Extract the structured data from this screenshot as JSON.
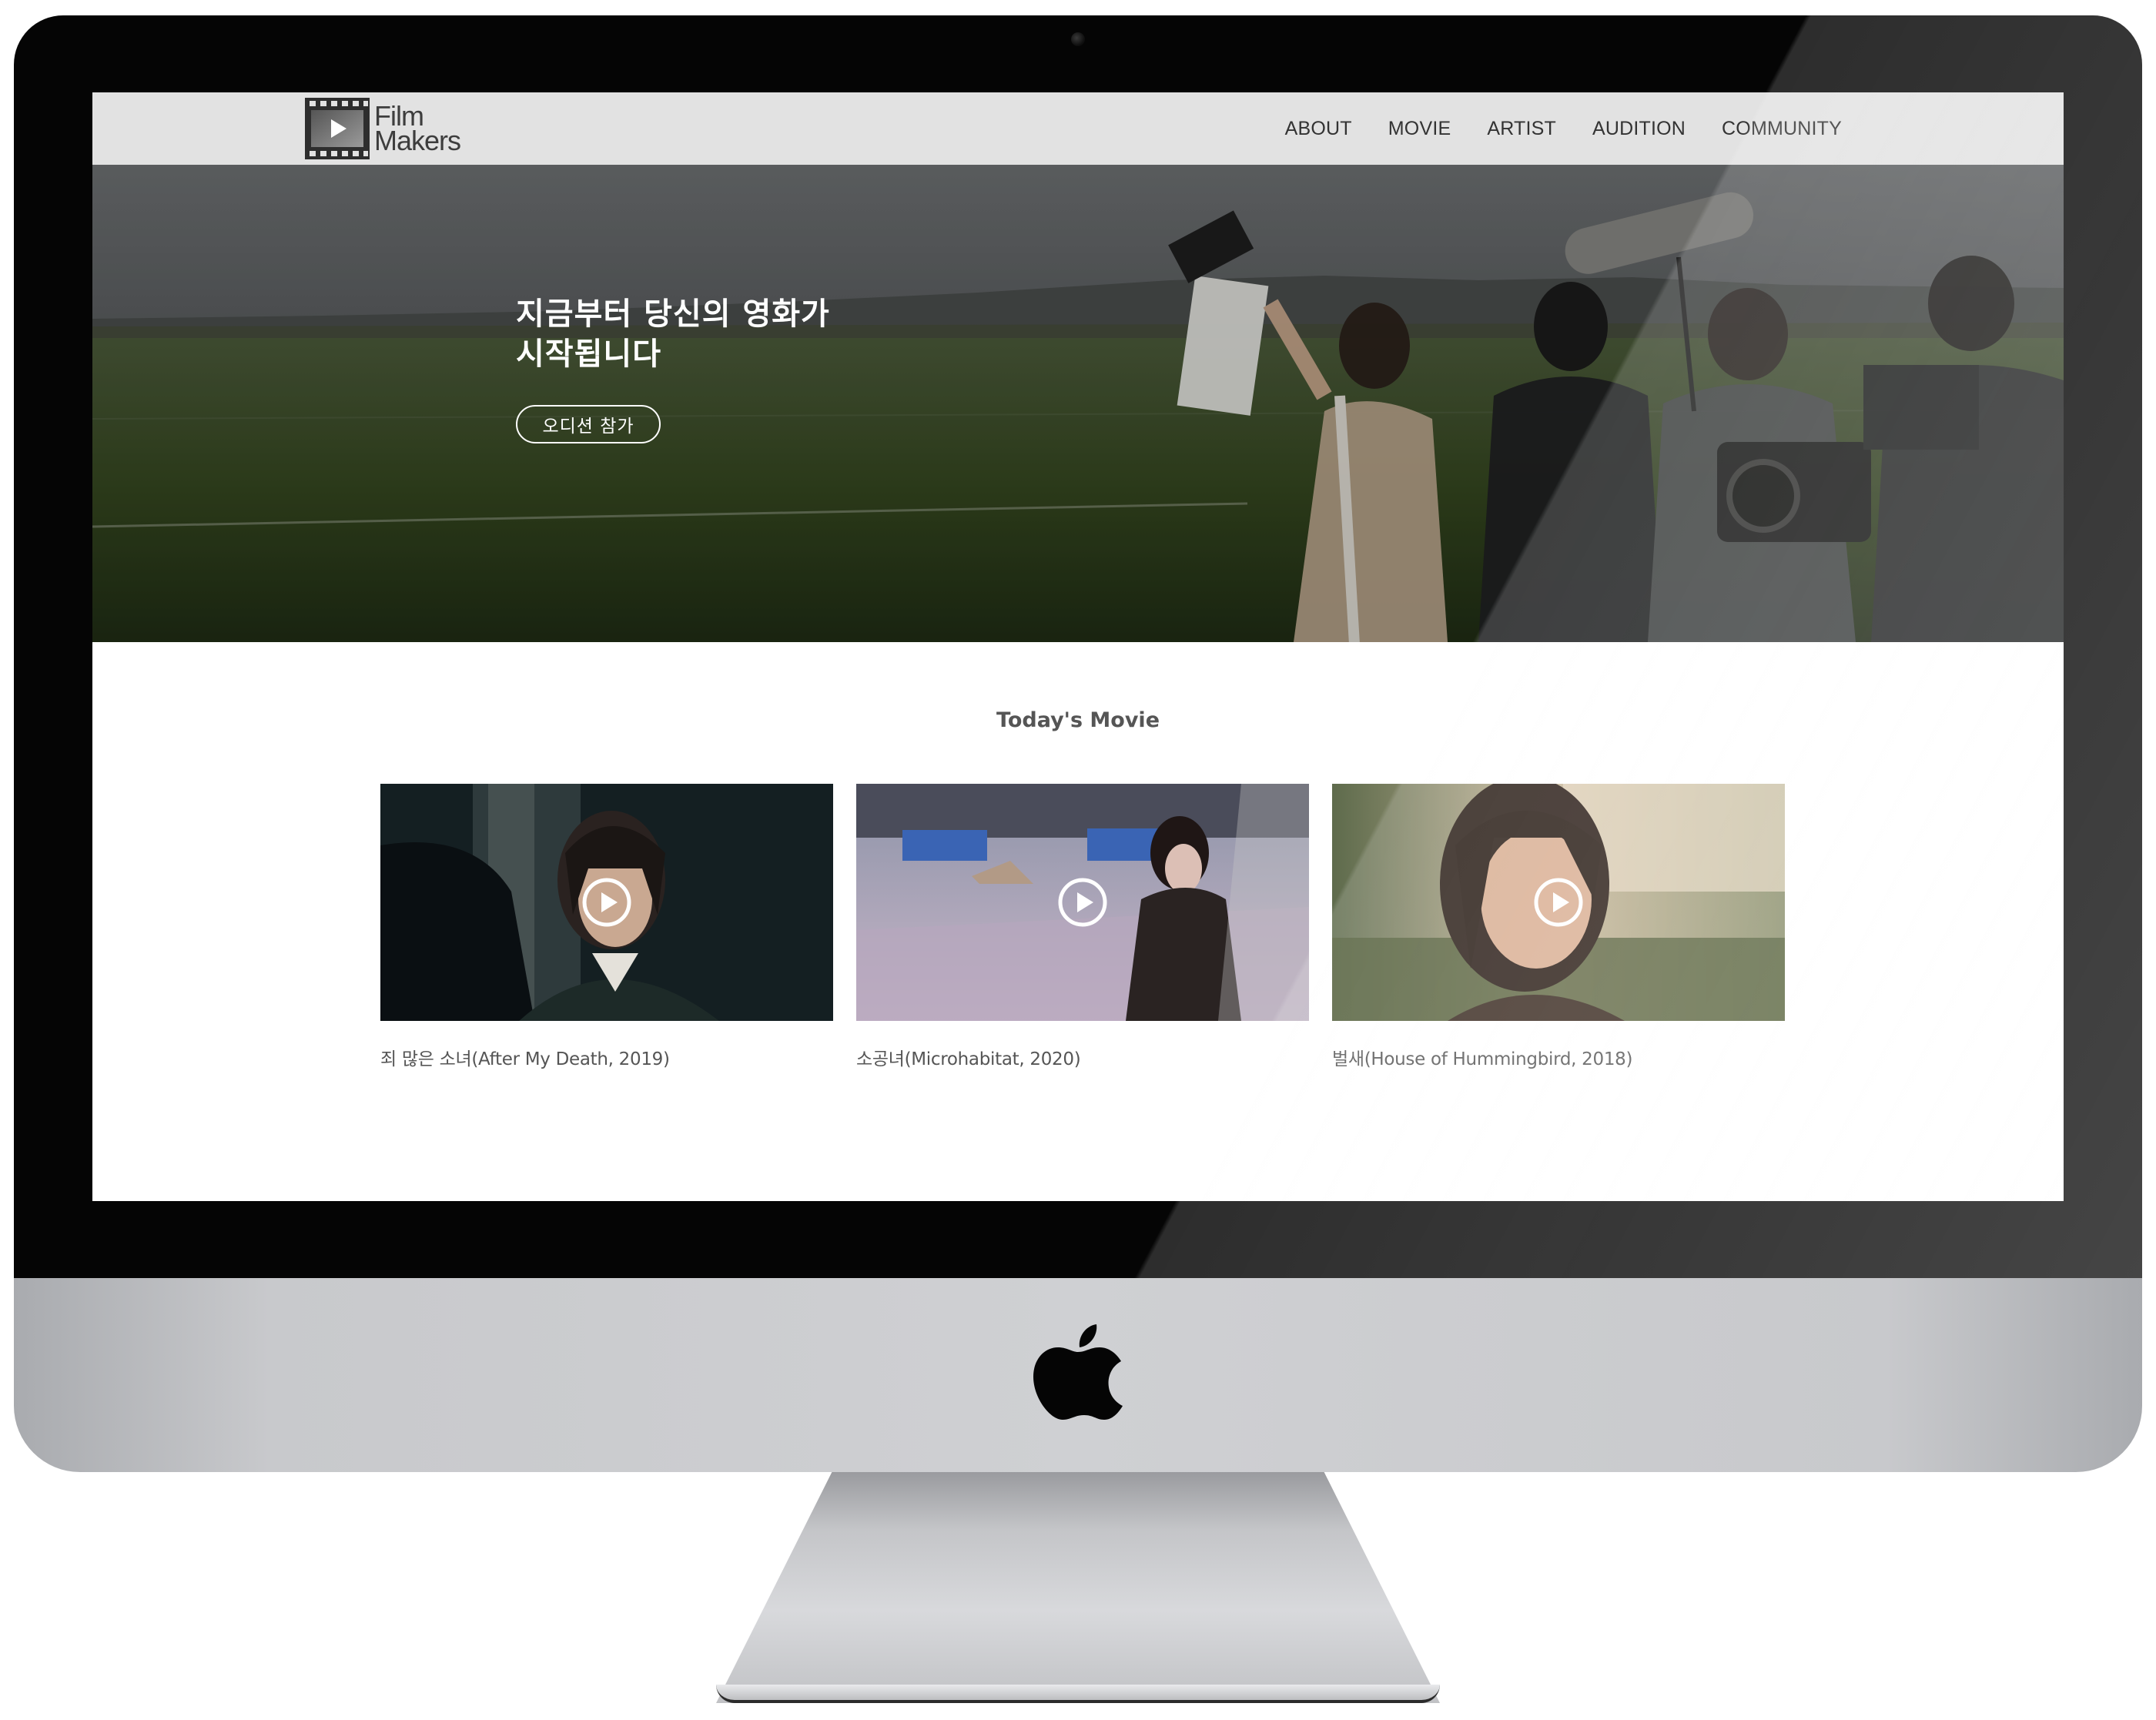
{
  "nav": {
    "logo": {
      "line1": "Film",
      "line2": "Makers",
      "icon": "film-play-icon"
    },
    "items": [
      {
        "label": "ABOUT"
      },
      {
        "label": "MOVIE"
      },
      {
        "label": "ARTIST"
      },
      {
        "label": "AUDITION"
      },
      {
        "label": "COMMUNITY"
      }
    ]
  },
  "hero": {
    "title": "지금부터 당신의 영화가\n시작됩니다",
    "button_label": "오디션 참가"
  },
  "todays_movie": {
    "title": "Today's Movie",
    "movies": [
      {
        "caption": "죄 많은 소녀(After My Death, 2019)",
        "icon": "play-icon"
      },
      {
        "caption": "소공녀(Microhabitat, 2020)",
        "icon": "play-icon"
      },
      {
        "caption": "벌새(House of Hummingbird, 2018)",
        "icon": "play-icon"
      }
    ]
  },
  "device": {
    "icon": "apple-logo-icon"
  },
  "colors": {
    "navbar_bg": "#e2e2e2",
    "nav_text": "#333333",
    "body_text": "#555555",
    "hero_text": "#ffffff",
    "bezel": "#050505",
    "chin": "#cfd0d3"
  }
}
